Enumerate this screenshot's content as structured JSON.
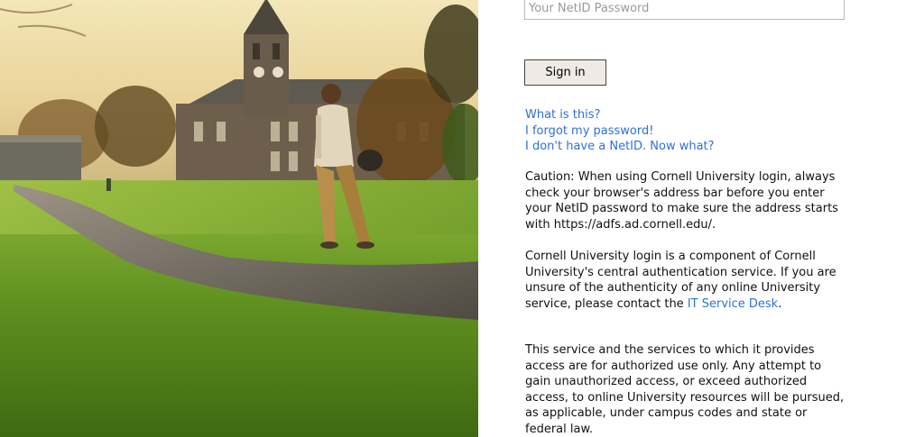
{
  "login": {
    "password_placeholder": "Your NetID Password",
    "signin_label": "Sign in"
  },
  "links": {
    "what_is_this": "What is this?",
    "forgot_password": "I forgot my password!",
    "no_netid": "I don't have a NetID. Now what?"
  },
  "caution": {
    "text": "Caution: When using Cornell University login, always check your browser's address bar before you enter your NetID password to make sure the address starts with https://adfs.ad.cornell.edu/."
  },
  "component": {
    "text_before": "Cornell University login is a component of Cornell University's central authentication service. If you are unsure of the authenticity of any online University service, please contact the ",
    "link_text": "IT Service Desk",
    "text_after": "."
  },
  "authorized": {
    "text": "This service and the services to which it provides access are for authorized use only. Any attempt to gain unauthorized access, or exceed authorized access, to online University resources will be pursued, as applicable, under campus codes and state or federal law."
  },
  "colors": {
    "link": "#2e70d8",
    "button_bg": "#efebe4"
  }
}
